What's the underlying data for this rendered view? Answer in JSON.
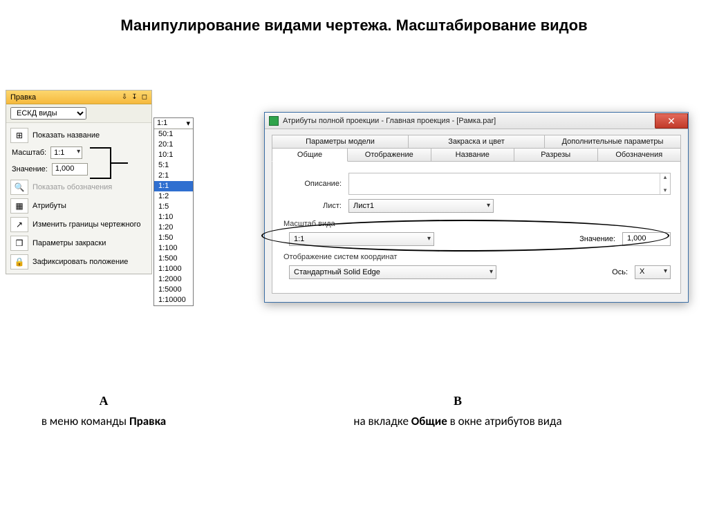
{
  "title": "Манипулирование видами чертежа. Масштабирование видов",
  "panelA": {
    "header": "Правка",
    "typeSelector": "ЕСКД виды",
    "showName": "Показать название",
    "scaleLabel": "Масштаб:",
    "scaleValue": "1:1",
    "valueLabel": "Значение:",
    "valueValue": "1,000",
    "showDesignations": "Показать обозначения",
    "attributes": "Атрибуты",
    "changeBounds": "Изменить границы чертежного",
    "fillParams": "Параметры закраски",
    "fixPosition": "Зафиксировать положение"
  },
  "dropdown": {
    "top": "1:1",
    "items": [
      "50:1",
      "20:1",
      "10:1",
      "5:1",
      "2:1",
      "1:1",
      "1:2",
      "1:5",
      "1:10",
      "1:20",
      "1:50",
      "1:100",
      "1:500",
      "1:1000",
      "1:2000",
      "1:5000",
      "1:10000"
    ],
    "selectedIndex": 5
  },
  "winB": {
    "title": "Атрибуты полной проекции - Главная проекция - [Рамка.par]",
    "tabsTop": [
      "Параметры модели",
      "Закраска и цвет",
      "Дополнительные параметры"
    ],
    "tabsBottom": [
      "Общие",
      "Отображение",
      "Название",
      "Разрезы",
      "Обозначения"
    ],
    "activeBottom": 0,
    "descLabel": "Описание:",
    "sheetLabel": "Лист:",
    "sheetValue": "Лист1",
    "scaleGroup": "Масштаб вида",
    "scaleValue": "1:1",
    "valLabel": "Значение:",
    "valValue": "1,000",
    "coordGroup": "Отображение систем координат",
    "coordValue": "Стандартный Solid Edge",
    "axisLabel": "Ось:",
    "axisValue": "X"
  },
  "captions": {
    "letterA": "А",
    "letterB": "В",
    "textA_pre": "в меню команды ",
    "textA_bold": "Правка",
    "textB_pre": "на вкладке ",
    "textB_bold": "Общие",
    "textB_post": " в окне атрибутов вида"
  }
}
